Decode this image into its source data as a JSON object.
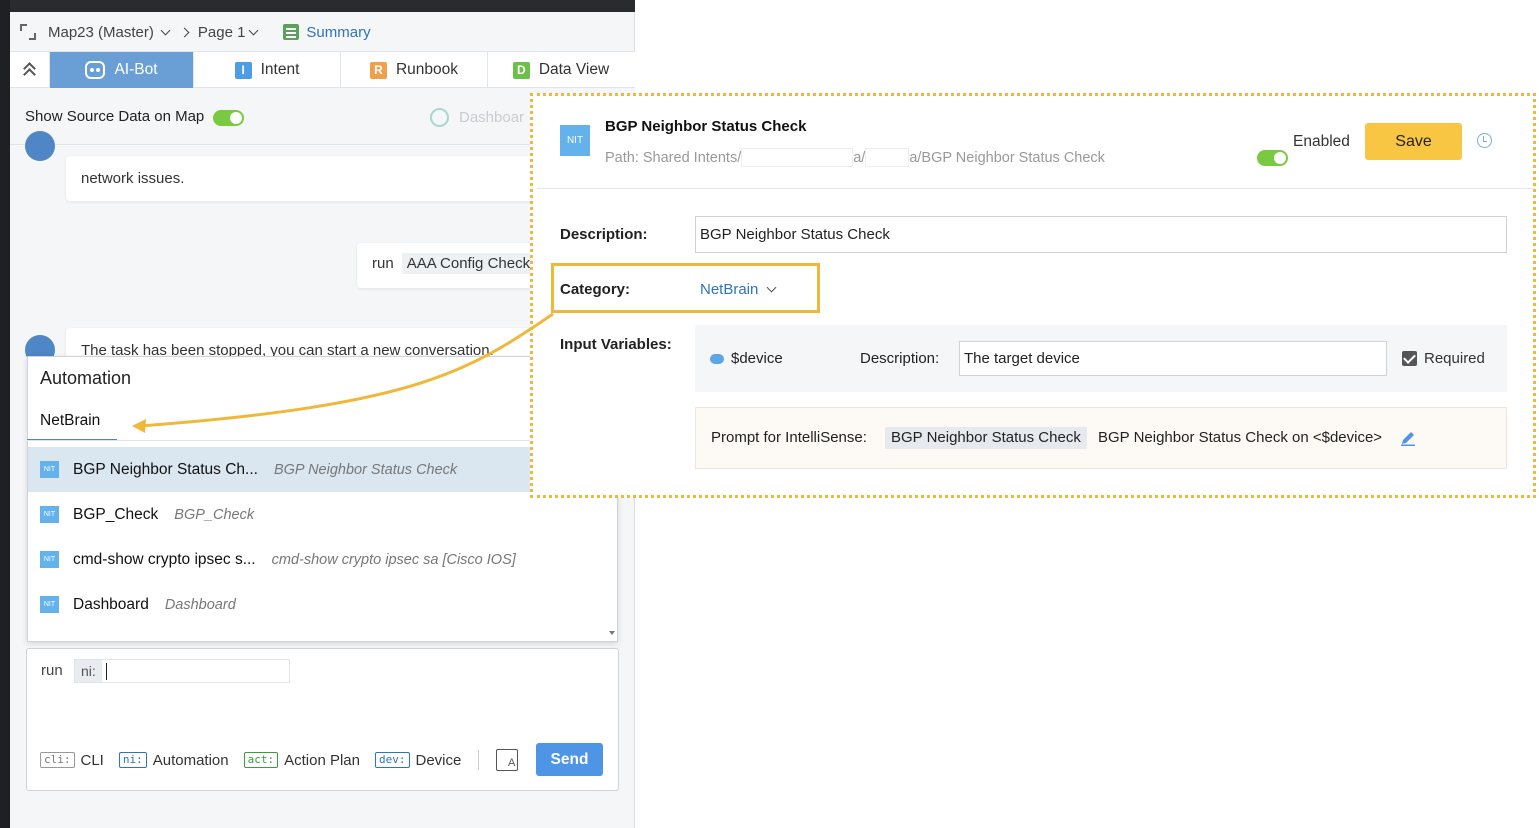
{
  "breadcrumb": {
    "map": "Map23 (Master)",
    "page": "Page 1",
    "summary": "Summary"
  },
  "tabs": [
    {
      "label": "AI-Bot"
    },
    {
      "label": "Intent",
      "icon_letter": "I",
      "color": "#4e9ce6"
    },
    {
      "label": "Runbook",
      "icon_letter": "R",
      "color": "#f0a04b"
    },
    {
      "label": "Data View",
      "icon_letter": "D",
      "color": "#6cc04a"
    }
  ],
  "source_bar": {
    "label": "Show Source Data on Map",
    "toggle_on": true,
    "dashboard": "Dashboar"
  },
  "chat": {
    "msg_network": "network issues.",
    "run_prefix": "run",
    "run_code": "AAA Config Check",
    "stopped": "The task has been stopped, you can start a new conversation."
  },
  "automation": {
    "title": "Automation",
    "tab": "NetBrain",
    "badge": "NIT",
    "items": [
      {
        "name": "BGP Neighbor Status Ch...",
        "desc": "BGP Neighbor Status Check"
      },
      {
        "name": "BGP_Check",
        "desc": "BGP_Check"
      },
      {
        "name": "cmd-show crypto ipsec s...",
        "desc": "cmd-show crypto ipsec sa [Cisco IOS]"
      },
      {
        "name": "Dashboard",
        "desc": "Dashboard"
      }
    ]
  },
  "input": {
    "run_label": "run",
    "chip": "ni:",
    "shortcuts": [
      {
        "chip": "cli:",
        "label": "CLI",
        "color": "#777777"
      },
      {
        "chip": "ni:",
        "label": "Automation",
        "color": "#2e74b8"
      },
      {
        "chip": "act:",
        "label": "Action Plan",
        "color": "#3d9a3d"
      },
      {
        "chip": "dev:",
        "label": "Device",
        "color": "#2e74b8"
      }
    ],
    "send": "Send"
  },
  "intent": {
    "badge": "NIT",
    "title": "BGP Neighbor Status Check",
    "path_prefix": "Path: Shared Intents/",
    "path_mid1": "a/",
    "path_mid2": "a/BGP Neighbor Status Check",
    "enabled_label": "Enabled",
    "save": "Save",
    "description_label": "Description:",
    "description_value": "BGP Neighbor Status Check",
    "category_label": "Category:",
    "category_value": "NetBrain",
    "input_vars_label": "Input Variables:",
    "var_name": "$device",
    "var_desc_label": "Description:",
    "var_desc_value": "The target device",
    "required_label": "Required",
    "prompt_label": "Prompt for IntelliSense:",
    "prompt_chip": "BGP Neighbor Status Check",
    "prompt_text": "BGP Neighbor Status Check on <$device>"
  },
  "colors": {
    "accent": "#4e86c6",
    "highlight": "#f0b83a",
    "save": "#f9c644",
    "toggle": "#7ac943"
  }
}
